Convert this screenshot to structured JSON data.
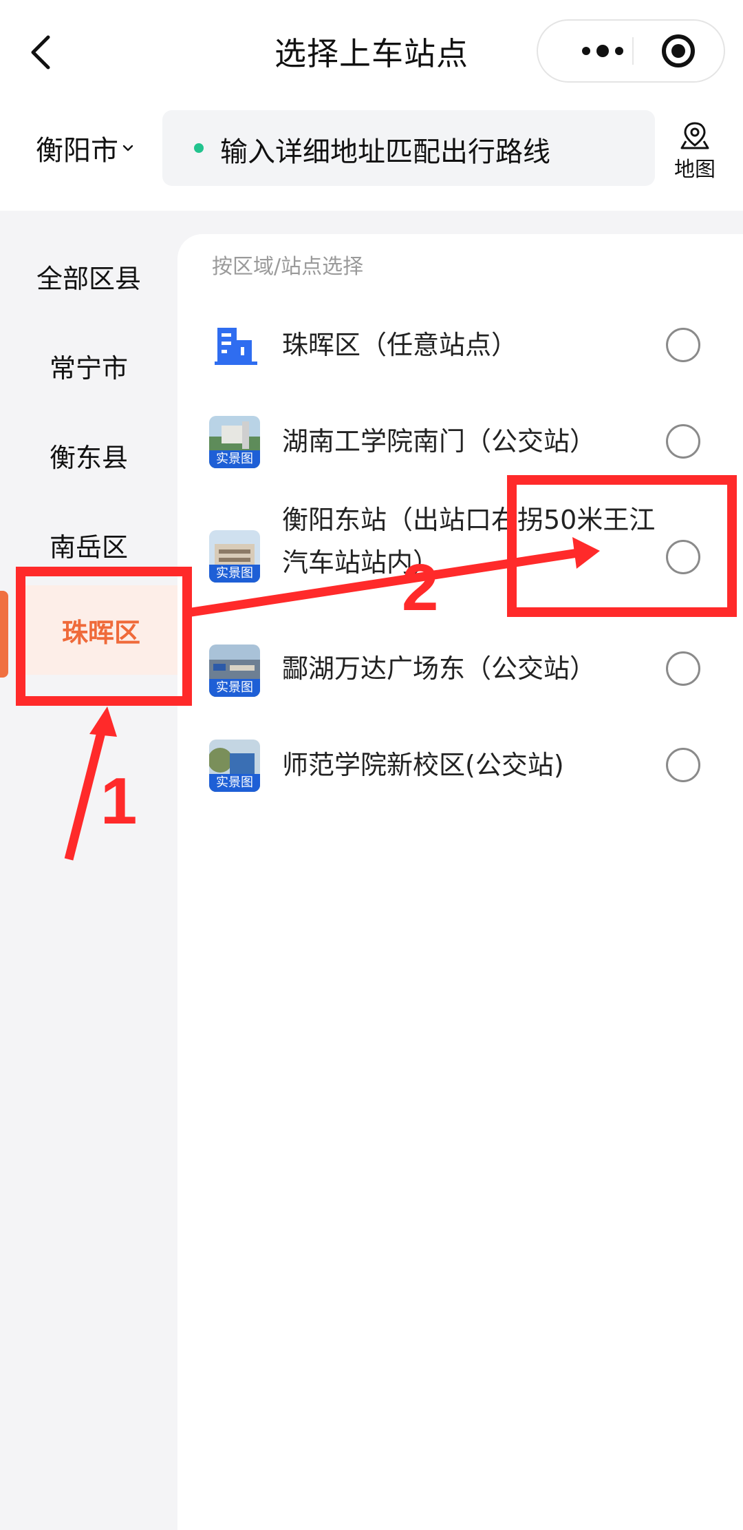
{
  "header": {
    "title": "选择上车站点",
    "back_icon": "chevron-left-icon",
    "menu_icon": "more-dots-icon",
    "close_icon": "target-circle-icon"
  },
  "search": {
    "city": "衡阳市",
    "placeholder": "输入详细地址匹配出行路线",
    "map_label": "地图",
    "dot_color": "#22c38e"
  },
  "sidebar": {
    "items": [
      {
        "label": "全部区县"
      },
      {
        "label": "常宁市"
      },
      {
        "label": "衡东县"
      },
      {
        "label": "南岳区"
      },
      {
        "label": "珠晖区",
        "active": true
      }
    ],
    "active_color": "#ef6a3a"
  },
  "main": {
    "section_label": "按区域/站点选择",
    "stations": [
      {
        "name": "珠晖区（任意站点）",
        "icon": "district-building-icon"
      },
      {
        "name": "湖南工学院南门（公交站）",
        "tag": "实景图"
      },
      {
        "name": "衡阳东站（出站口右拐50米王江汽车站站内）",
        "tag": "实景图"
      },
      {
        "name": "酃湖万达广场东（公交站）",
        "tag": "实景图"
      },
      {
        "name": "师范学院新校区(公交站)",
        "tag": "实景图"
      }
    ]
  },
  "annotations": {
    "labels": [
      "1",
      "2"
    ],
    "color": "#ff2a2a"
  }
}
